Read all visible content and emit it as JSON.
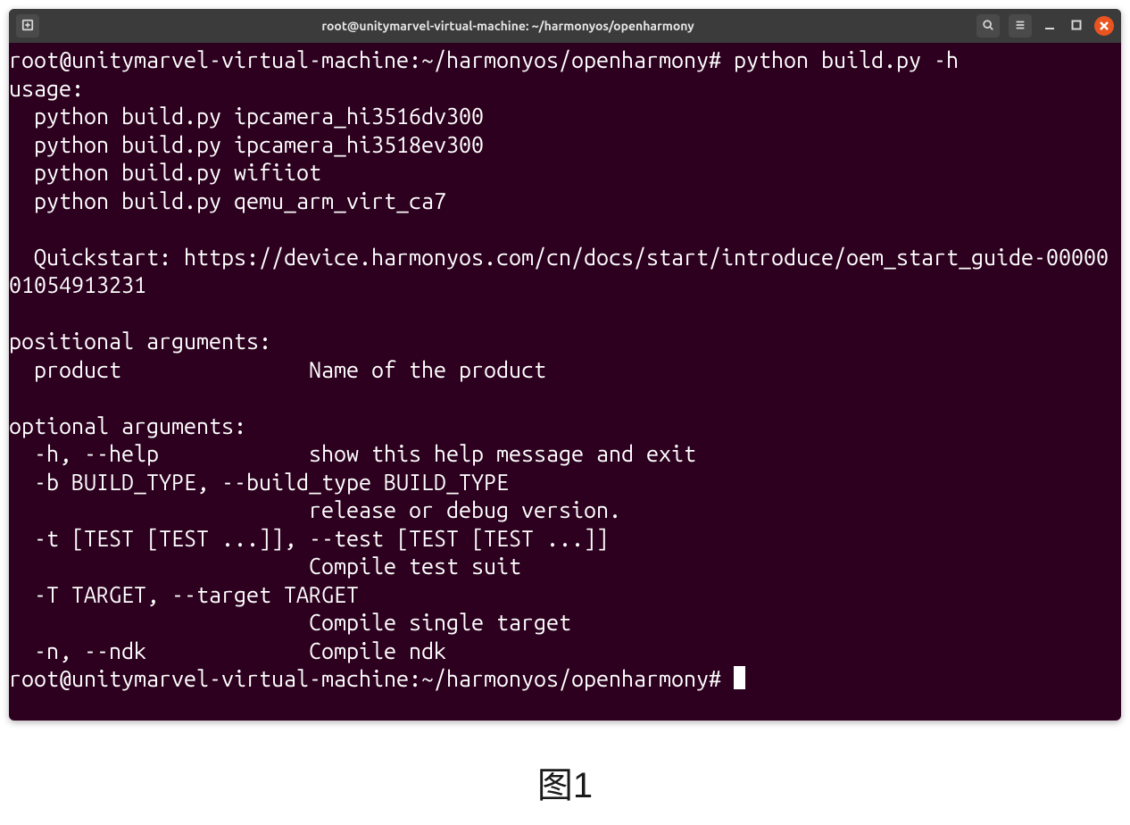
{
  "titlebar": {
    "title": "root@unitymarvel-virtual-machine: ~/harmonyos/openharmony"
  },
  "terminal": {
    "prompt1": "root@unitymarvel-virtual-machine:~/harmonyos/openharmony# ",
    "command1": "python build.py -h",
    "line_usage": "usage:",
    "line_ex1": "  python build.py ipcamera_hi3516dv300",
    "line_ex2": "  python build.py ipcamera_hi3518ev300",
    "line_ex3": "  python build.py wifiiot",
    "line_ex4": "  python build.py qemu_arm_virt_ca7",
    "line_quickstart": "  Quickstart: https://device.harmonyos.com/cn/docs/start/introduce/oem_start_guide-0000001054913231",
    "line_posargs_hdr": "positional arguments:",
    "line_product": "  product               Name of the product",
    "line_optargs_hdr": "optional arguments:",
    "line_help": "  -h, --help            show this help message and exit",
    "line_buildtype1": "  -b BUILD_TYPE, --build_type BUILD_TYPE",
    "line_buildtype2": "                        release or debug version.",
    "line_test1": "  -t [TEST [TEST ...]], --test [TEST [TEST ...]]",
    "line_test2": "                        Compile test suit",
    "line_target1": "  -T TARGET, --target TARGET",
    "line_target2": "                        Compile single target",
    "line_ndk": "  -n, --ndk             Compile ndk",
    "prompt2": "root@unitymarvel-virtual-machine:~/harmonyos/openharmony# "
  },
  "caption": "图1"
}
